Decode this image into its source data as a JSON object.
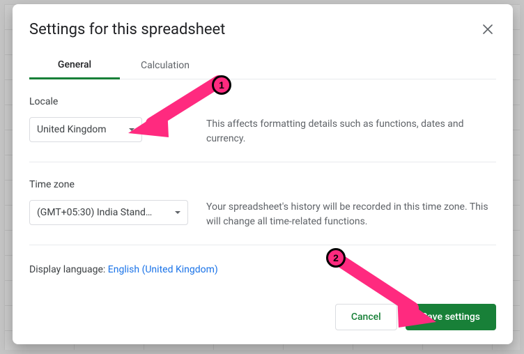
{
  "dialog": {
    "title": "Settings for this spreadsheet"
  },
  "tabs": {
    "general": "General",
    "calculation": "Calculation"
  },
  "locale": {
    "label": "Locale",
    "value": "United Kingdom",
    "desc": "This affects formatting details such as functions, dates and currency."
  },
  "timezone": {
    "label": "Time zone",
    "value": "(GMT+05:30) India Stand…",
    "desc": "Your spreadsheet's history will be recorded in this time zone. This will change all time-related functions."
  },
  "language": {
    "label": "Display language: ",
    "link": "English (United Kingdom)"
  },
  "buttons": {
    "cancel": "Cancel",
    "save": "Save settings"
  },
  "annotations": {
    "b1": "1",
    "b2": "2"
  }
}
